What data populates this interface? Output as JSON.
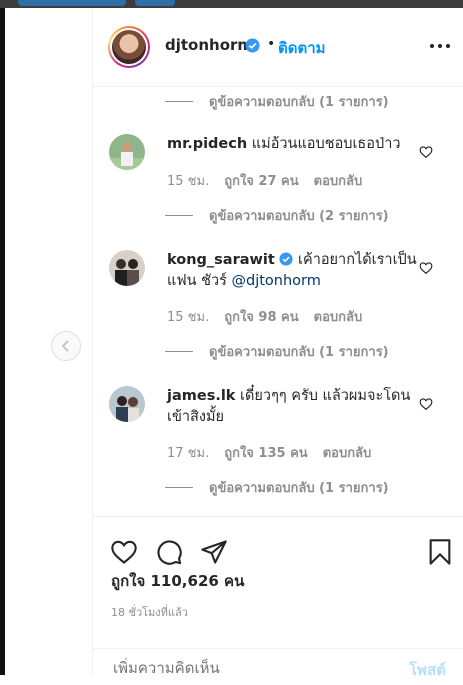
{
  "header": {
    "username": "djtonhorm",
    "separator": "•",
    "follow_label": "ติดตาม"
  },
  "replies": [
    {
      "label": "ดูข้อความตอบกลับ (1 รายการ)"
    },
    {
      "label": "ดูข้อความตอบกลับ (2 รายการ)"
    },
    {
      "label": "ดูข้อความตอบกลับ (1 รายการ)"
    },
    {
      "label": "ดูข้อความตอบกลับ (1 รายการ)"
    }
  ],
  "comments": [
    {
      "username": "mr.pidech",
      "text": " แม่อ้วนแอบชอบเธอป่าว",
      "time": "15 ชม.",
      "likes": "ถูกใจ 27 คน",
      "reply_label": "ตอบกลับ"
    },
    {
      "username": "kong_sarawit",
      "text": " เค้าอยากได้เราเป็นแฟน ชัวร์ ",
      "mention": "@djtonhorm",
      "time": "15 ชม.",
      "likes": "ถูกใจ 98 คน",
      "reply_label": "ตอบกลับ"
    },
    {
      "username": "james.lk",
      "text": " เดี๋ยวๆๆ ครับ แล้วผมจะโดนเข้าสิงมั้ย",
      "time": "17 ชม.",
      "likes": "ถูกใจ 135 คน",
      "reply_label": "ตอบกลับ"
    }
  ],
  "post": {
    "likes": "ถูกใจ 110,626 คน",
    "time_ago": "18 ชั่วโมงที่แล้ว"
  },
  "add_comment": {
    "placeholder": "เพิ่มความคิดเห็น",
    "post_label": "โพสต์"
  },
  "colors": {
    "link": "#0095f6",
    "muted": "#8e8e8e",
    "text": "#262626"
  }
}
